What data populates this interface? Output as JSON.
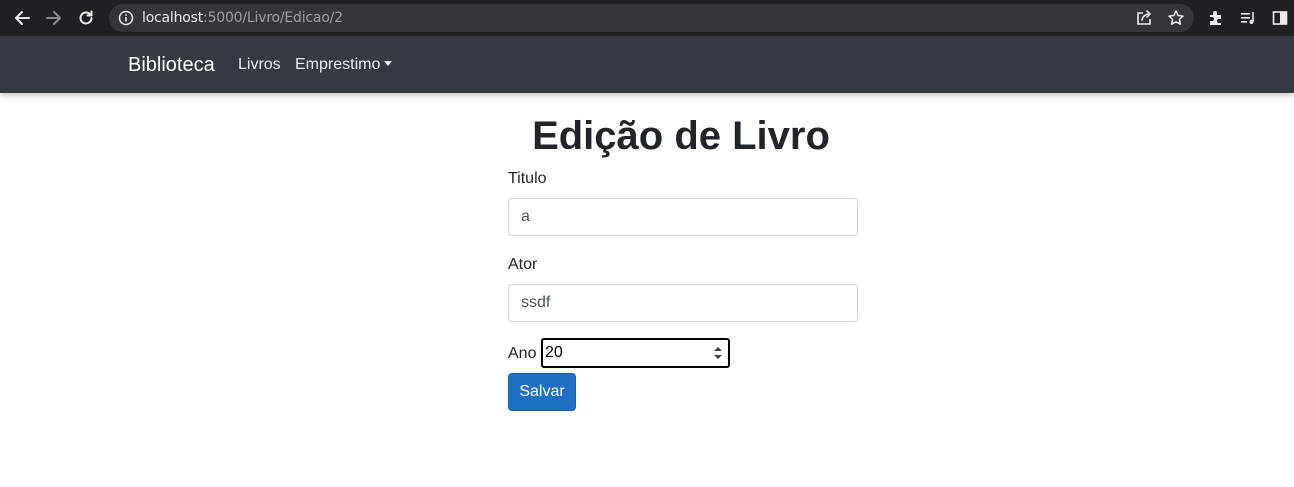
{
  "browser": {
    "url_host": "localhost",
    "url_path": ":5000/Livro/Edicao/2"
  },
  "navbar": {
    "brand": "Biblioteca",
    "links": [
      {
        "label": "Livros"
      },
      {
        "label": "Emprestimo"
      }
    ]
  },
  "page": {
    "title": "Edição de Livro"
  },
  "form": {
    "titulo": {
      "label": "Titulo",
      "value": "a"
    },
    "ator": {
      "label": "Ator",
      "value": "ssdf"
    },
    "ano": {
      "label": "Ano",
      "value": "20"
    },
    "submit_label": "Salvar"
  },
  "colors": {
    "navbar_bg": "#343a40",
    "primary": "#1f6fc3",
    "chrome_bg": "#202124"
  }
}
